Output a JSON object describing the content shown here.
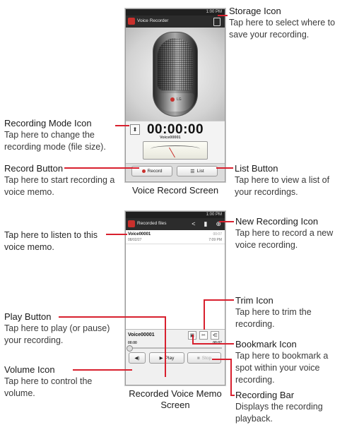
{
  "voice_record_screen": {
    "caption": "Voice Record Screen",
    "status_time": "1:00 PM",
    "app_title": "Voice Recorder",
    "brand_text": "LG",
    "timer": "00:00:00",
    "file_name": "Voice00001",
    "record_label": "Record",
    "list_label": "List"
  },
  "recorded_screen": {
    "caption": "Recorded Voice Memo Screen",
    "status_time": "1:00 PM",
    "title": "Recorded files",
    "list_item": {
      "name": "Voice00001",
      "date": "08/02/27",
      "time": "7:09 PM",
      "duration": "00:07"
    },
    "file_name": "Voice00001",
    "time_start": "00:00",
    "time_end": "00:07",
    "play_label": "Play",
    "stop_label": "Stop"
  },
  "callouts": {
    "storage_icon": {
      "title": "Storage Icon",
      "desc": "Tap here to select where to save your recording."
    },
    "recording_mode_icon": {
      "title": "Recording Mode Icon",
      "desc": "Tap here to change the recording mode (file size)."
    },
    "record_button": {
      "title": "Record Button",
      "desc": "Tap here to start recording a voice memo."
    },
    "list_button": {
      "title": "List Button",
      "desc": "Tap here to view a list of your recordings."
    },
    "listen_memo": {
      "desc": "Tap here to listen to this voice memo."
    },
    "new_recording_icon": {
      "title": "New Recording Icon",
      "desc": "Tap here to record a new voice recording."
    },
    "trim_icon": {
      "title": "Trim Icon",
      "desc": "Tap here to trim the recording."
    },
    "play_button": {
      "title": "Play Button",
      "desc": "Tap here to play (or pause) your recording."
    },
    "bookmark_icon": {
      "title": "Bookmark Icon",
      "desc": "Tap here to bookmark a spot within your voice recording."
    },
    "volume_icon": {
      "title": "Volume Icon",
      "desc": "Tap here to control the volume."
    },
    "recording_bar": {
      "title": "Recording Bar",
      "desc": "Displays the recording playback."
    }
  },
  "colors": {
    "leader_line": "#d8202e",
    "record_dot": "#c9302c"
  },
  "icons": [
    "storage-icon",
    "recording-mode-icon",
    "share-icon",
    "delete-icon",
    "new-recording-icon",
    "bookmark-icon",
    "trim-icon",
    "split-icon",
    "volume-icon",
    "play-icon",
    "stop-icon",
    "list-icon"
  ]
}
